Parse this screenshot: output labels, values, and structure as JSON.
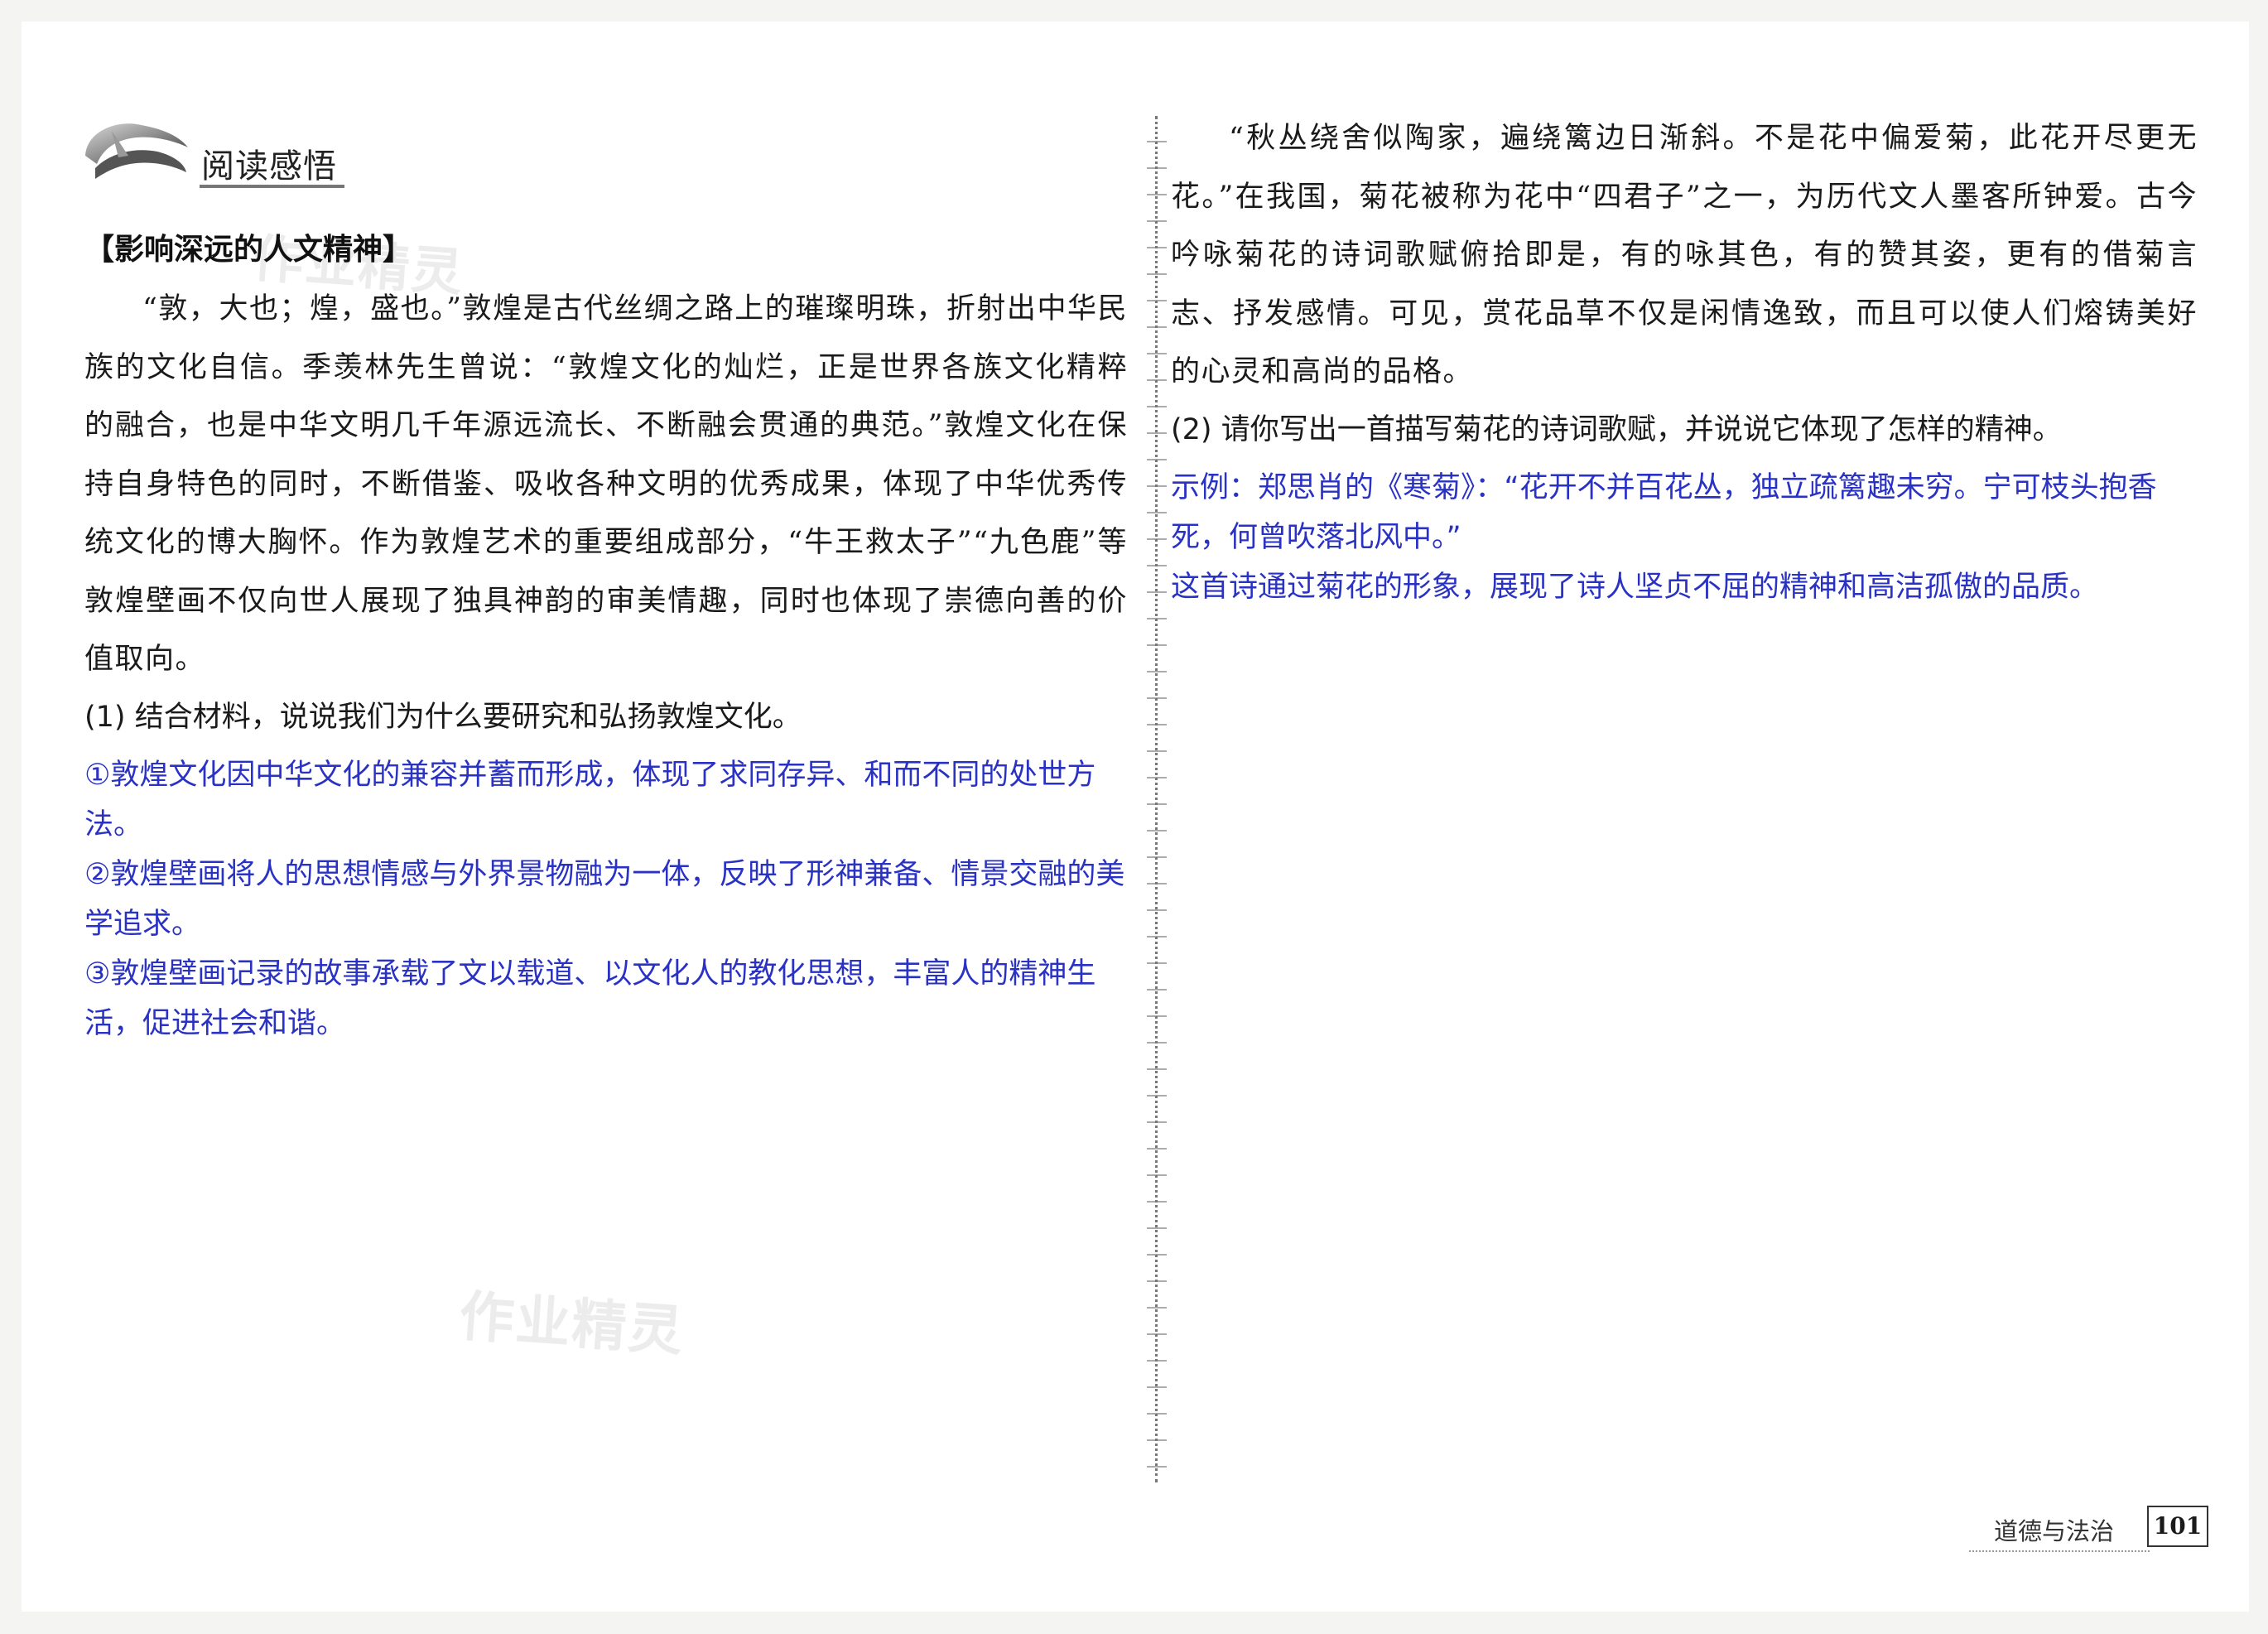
{
  "header": {
    "title": "阅读感悟"
  },
  "left": {
    "subhead": "【影响深远的人文精神】",
    "passage": "“敦，大也；煌，盛也。”敦煌是古代丝绸之路上的璀璨明珠，折射出中华民族的文化自信。季羡林先生曾说：“敦煌文化的灿烂，正是世界各族文化精粹的融合，也是中华文明几千年源远流长、不断融会贯通的典范。”敦煌文化在保持自身特色的同时，不断借鉴、吸收各种文明的优秀成果，体现了中华优秀传统文化的博大胸怀。作为敦煌艺术的重要组成部分，“牛王救太子”“九色鹿”等敦煌壁画不仅向世人展现了独具神韵的审美情趣，同时也体现了崇德向善的价值取向。",
    "q1": "(1) 结合材料，说说我们为什么要研究和弘扬敦煌文化。",
    "a1": [
      "①敦煌文化因中华文化的兼容并蓄而形成，体现了求同存异、和而不同的处世方法。",
      "②敦煌壁画将人的思想情感与外界景物融为一体，反映了形神兼备、情景交融的美学追求。",
      "③敦煌壁画记录的故事承载了文以载道、以文化人的教化思想，丰富人的精神生活，促进社会和谐。"
    ]
  },
  "right": {
    "passage": "“秋丛绕舍似陶家，遍绕篱边日渐斜。不是花中偏爱菊，此花开尽更无花。”在我国，菊花被称为花中“四君子”之一，为历代文人墨客所钟爱。古今吟咏菊花的诗词歌赋俯拾即是，有的咏其色，有的赞其姿，更有的借菊言志、抒发感情。可见，赏花品草不仅是闲情逸致，而且可以使人们熔铸美好的心灵和高尚的品格。",
    "q2": "(2) 请你写出一首描写菊花的诗词歌赋，并说说它体现了怎样的精神。",
    "a2": [
      "示例：郑思肖的《寒菊》：“花开不并百花丛，独立疏篱趣未穷。宁可枝头抱香死，何曾吹落北风中。”",
      "这首诗通过菊花的形象，展现了诗人坚贞不屈的精神和高洁孤傲的品质。"
    ]
  },
  "watermarks": [
    "作业精灵",
    "作业精灵"
  ],
  "footer": {
    "subject": "道德与法治",
    "page": "101"
  }
}
